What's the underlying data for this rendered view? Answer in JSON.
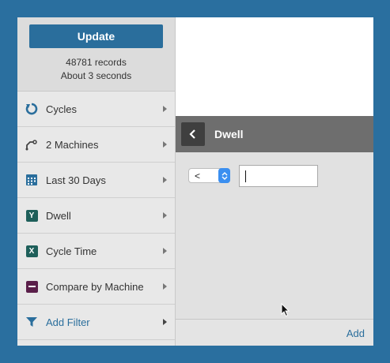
{
  "sidebar": {
    "update_label": "Update",
    "records_count": "48781 records",
    "records_time": "About 3 seconds",
    "items": [
      {
        "label": "Cycles",
        "icon": "cycle-icon"
      },
      {
        "label": "2 Machines",
        "icon": "machine-icon"
      },
      {
        "label": "Last 30 Days",
        "icon": "calendar-icon"
      },
      {
        "label": "Dwell",
        "icon": "y-axis-icon",
        "badge": "Y",
        "color": "#1e5f5a"
      },
      {
        "label": "Cycle Time",
        "icon": "x-axis-icon",
        "badge": "X",
        "color": "#1e5f5a"
      },
      {
        "label": "Compare by Machine",
        "icon": "compare-icon",
        "color": "#5a1f4a"
      },
      {
        "label": "Add Filter",
        "icon": "filter-icon"
      }
    ]
  },
  "filter_panel": {
    "title": "Dwell",
    "operator": "<",
    "value": "",
    "add_label": "Add"
  },
  "colors": {
    "accent": "#2a6e9c",
    "background": "#2a6f9f",
    "header": "#6e6e6e"
  }
}
